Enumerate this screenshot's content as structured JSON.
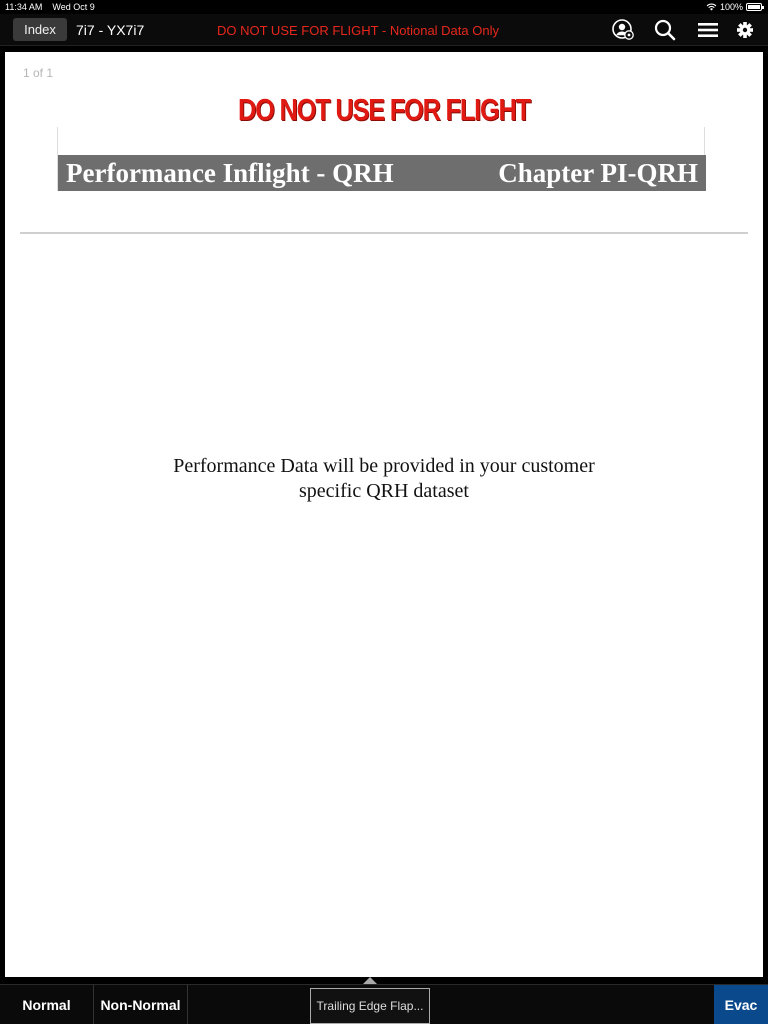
{
  "status_bar": {
    "time": "11:34 AM",
    "date": "Wed Oct 9",
    "battery": "100%"
  },
  "nav": {
    "index_label": "Index",
    "doc_id": "7i7 - YX7i7",
    "warning": "DO NOT USE FOR FLIGHT - Notional Data Only",
    "icons": [
      "user-settings-icon",
      "search-icon",
      "menu-icon",
      "gear-icon"
    ]
  },
  "page": {
    "counter": "1 of 1",
    "dnu_header": "DO NOT USE FOR FLIGHT",
    "chapter_title_left": "Performance Inflight - QRH",
    "chapter_title_right": "Chapter PI-QRH",
    "note_line1": "Performance Data will be provided in your customer",
    "note_line2": "specific QRH dataset"
  },
  "tabs": {
    "normal": "Normal",
    "non_normal": "Non-Normal",
    "current_procedure": "Trailing Edge Flap...",
    "evac": "Evac"
  },
  "colors": {
    "warning_red": "#e8271c",
    "evac_blue": "#0a4a8c",
    "chapter_gray": "#6e6e6e"
  }
}
